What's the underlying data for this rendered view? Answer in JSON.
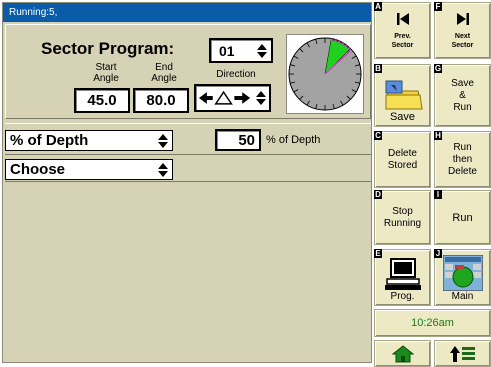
{
  "status": "Running:5,",
  "sector": {
    "title": "Sector Program:",
    "program_number": "01",
    "start_label_1": "Start",
    "start_label_2": "Angle",
    "end_label_1": "End",
    "end_label_2": "Angle",
    "direction_label": "Direction",
    "start_angle": "45.0",
    "end_angle": "80.0"
  },
  "depth": {
    "mode": "% of Depth",
    "value": "50",
    "unit": "% of Depth"
  },
  "choose_label": "Choose",
  "buttons": {
    "A": {
      "key": "A",
      "line1": "Prev.",
      "line2": "Sector"
    },
    "F": {
      "key": "F",
      "line1": "Next",
      "line2": "Sector"
    },
    "B": {
      "key": "B",
      "label": "Save"
    },
    "G": {
      "key": "G",
      "line1": "Save",
      "line2": "&",
      "line3": "Run"
    },
    "C": {
      "key": "C",
      "line1": "Delete",
      "line2": "Stored"
    },
    "H": {
      "key": "H",
      "line1": "Run",
      "line2": "then",
      "line3": "Delete"
    },
    "D": {
      "key": "D",
      "line1": "Stop",
      "line2": "Running"
    },
    "I": {
      "key": "I",
      "label": "Run"
    },
    "E": {
      "key": "E",
      "label": "Prog."
    },
    "J": {
      "key": "J",
      "label": "Main"
    }
  },
  "clock": "10:26am",
  "colors": {
    "status_bar": "#0a5ba8",
    "panel_bg": "#d5d2b6",
    "button_bg": "#ece9c4",
    "sector_green": "#1fd11f",
    "sector_magenta": "#d040d0"
  },
  "icons": {
    "prev": "skip-back-icon",
    "next": "skip-forward-icon",
    "save": "folder-save-icon",
    "prog": "computer-icon",
    "main": "main-screen-icon",
    "home": "home-icon",
    "up": "up-list-icon",
    "direction": "direction-arrows-icon"
  }
}
